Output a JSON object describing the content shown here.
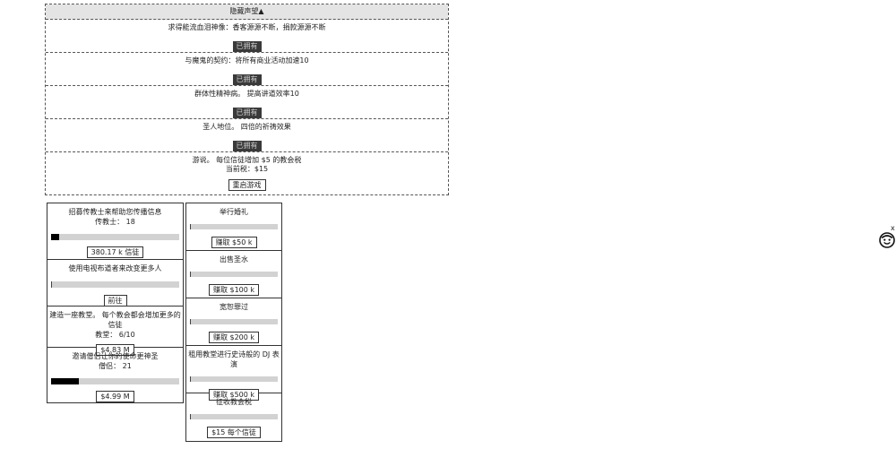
{
  "reputation": {
    "header": "隐藏声望▲",
    "items": [
      {
        "desc": "求得能流血泪神像：香客源源不断，捐款源源不断",
        "status": "已拥有"
      },
      {
        "desc": "与魔鬼的契约：将所有商业活动加速10",
        "status": "已拥有"
      },
      {
        "desc": "群体性精神病。 提高讲道效率10",
        "status": "已拥有"
      },
      {
        "desc": "圣人地位。 四倍的祈祷效果",
        "status": "已拥有"
      }
    ],
    "final": {
      "desc": "游说。 每位信徒增加 $5 的教会税",
      "current": "当前税：$15",
      "button": "重启游戏"
    }
  },
  "upgrades": [
    {
      "title": "招募传教士来帮助您传播信息",
      "sub": "传教士： 18",
      "progress": 0.06,
      "button": "380.17 k 信徒"
    },
    {
      "title": "使用电视布道者来改变更多人",
      "sub": "",
      "progress": 0.0,
      "button": "前往"
    },
    {
      "title": "建造一座教堂。 每个教会都会增加更多的信徒",
      "sub": "教堂： 6/10",
      "progress": null,
      "button": "$4.83 M"
    },
    {
      "title": "邀请僧侣让你的使命更神圣",
      "sub": "僧侣： 21",
      "progress": 0.22,
      "button": "$4.99 M"
    }
  ],
  "jobs": [
    {
      "title": "举行婚礼",
      "button": "赚取 $50 k"
    },
    {
      "title": "出售圣水",
      "button": "赚取 $100 k"
    },
    {
      "title": "宽恕罪过",
      "button": "赚取 $200 k"
    },
    {
      "title": "租用教堂进行史诗般的 DJ 表演",
      "button": "赚取 $500 k"
    },
    {
      "title": "征收教会税",
      "button": "$15 每个信徒"
    }
  ],
  "avatar": {
    "icon": "smiley-face-icon",
    "close": "x"
  }
}
